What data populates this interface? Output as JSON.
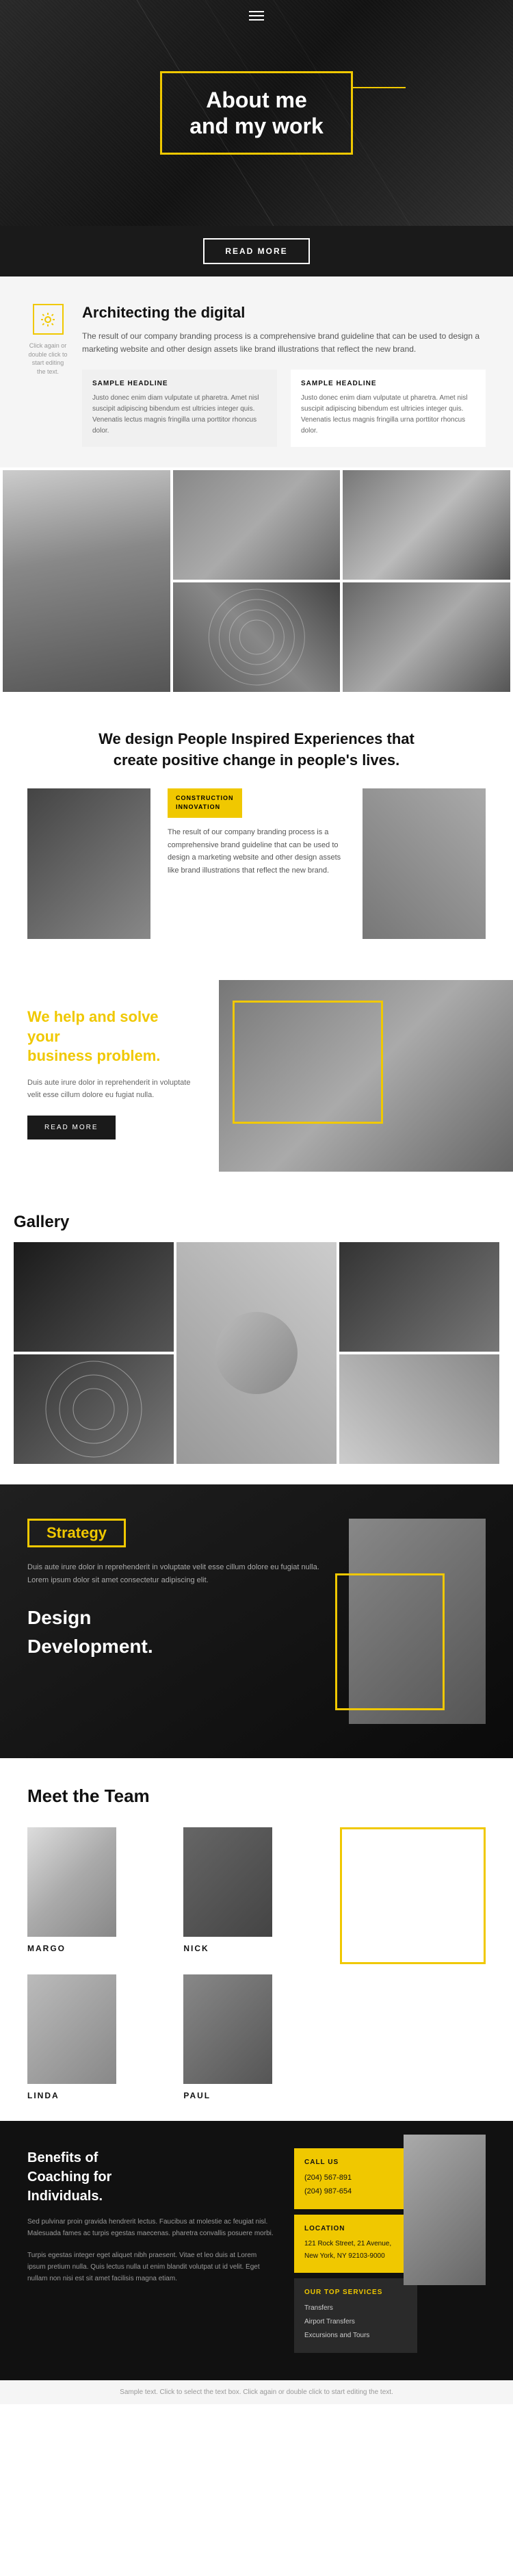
{
  "hero": {
    "title": "About me\nand my work",
    "menu_icon": "☰"
  },
  "hero_btn": {
    "label": "READ MORE"
  },
  "architecting": {
    "icon": "✦",
    "click_text": "Click again or double click to start editing the text.",
    "title": "Architecting the digital",
    "description": "The result of our company branding process is a comprehensive brand guideline that can be used to design a marketing website and other design assets like brand illustrations that reflect the new brand.",
    "col1_headline": "SAMPLE HEADLINE",
    "col1_text": "Justo donec enim diam vulputate ut pharetra. Amet nisl suscipit adipiscing bibendum est ultricies integer quis. Venenatis lectus magnis fringilla urna porttitor rhoncus dolor.",
    "col2_headline": "SAMPLE HEADLINE",
    "col2_text": "Justo donec enim diam vulputate ut pharetra. Amet nisl suscipit adipiscing bibendum est ultricies integer quis. Venenatis lectus magnis fringilla urna porttitor rhoncus dolor."
  },
  "design_section": {
    "title": "We design People Inspired Experiences that\ncreate positive change in people's lives.",
    "badge": "CONSTRUCTION\nINNOVATION",
    "text": "The result of our company branding process is a comprehensive brand guideline that can be used to design a marketing website and other design assets like brand illustrations that reflect the new brand."
  },
  "business": {
    "title_line1": "We help and solve your",
    "title_line2": "business",
    "title_highlight": "problem.",
    "text": "Duis aute irure dolor in reprehenderit in voluptate velit esse cillum dolore eu fugiat nulla.",
    "btn_label": "READ MORE"
  },
  "gallery": {
    "title": "Gallery"
  },
  "strategy": {
    "label": "Strategy",
    "text": "Duis aute irure dolor in reprehenderit in voluptate velit esse cillum dolore eu fugiat nulla. Lorem ipsum dolor sit amet consectetur adipiscing elit.",
    "design_label": "Design",
    "development_label": "Development."
  },
  "team": {
    "title": "Meet the Team",
    "members": [
      {
        "name": "MARGO"
      },
      {
        "name": "NICK"
      },
      {
        "name": ""
      },
      {
        "name": "LINDA"
      },
      {
        "name": "PAUL"
      }
    ]
  },
  "benefits": {
    "title": "Benefits of\nCoaching for\nIndividuals.",
    "text1": "Sed pulvinar proin gravida hendrerit lectus. Faucibus at molestie ac feugiat nisl. Malesuada fames ac turpis egestas maecenas. pharetra convallis posuere morbi.",
    "text2": "Turpis egestas integer eget aliquet nibh praesent. Vitae et leo duis at Lorem ipsum pretium nulla. Quis lectus nulla ut enim blandit volutpat ut id velit. Eget nullam non nisi est sit amet facilisis magna etiam.",
    "call_us_label": "CALL US",
    "phone1": "(204) 567-891",
    "phone2": "(204) 987-654",
    "location_label": "LOCATION",
    "address": "121 Rock Street, 21 Avenue,\nNew York, NY 92103-9000",
    "services_label": "OUR TOP SERVICES",
    "services": [
      "Transfers",
      "Airport Transfers",
      "Excursions and Tours"
    ]
  },
  "footer": {
    "text": "Sample text. Click to select the text box. Click again or double click to start editing the text."
  }
}
